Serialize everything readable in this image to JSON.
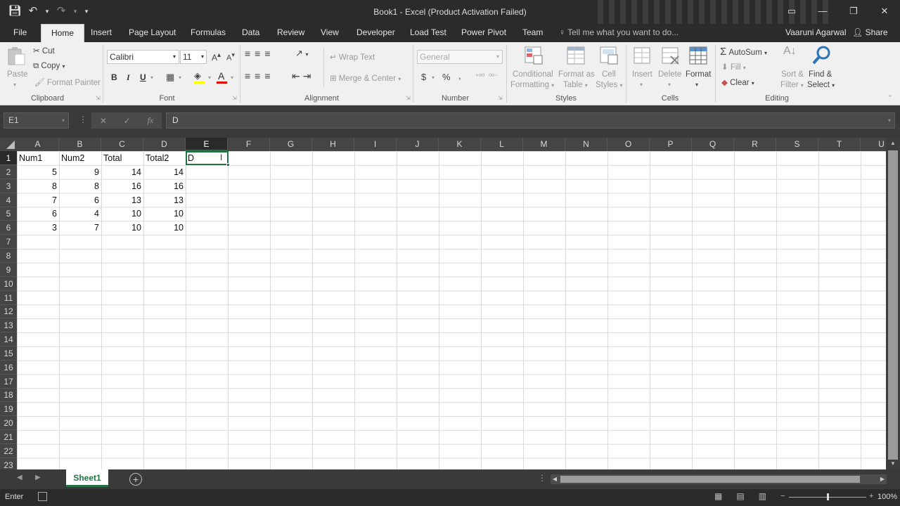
{
  "window": {
    "title": "Book1 - Excel (Product Activation Failed)",
    "controls": {
      "restore": "▭",
      "minimize": "—",
      "maximize": "❐",
      "close": "✕"
    }
  },
  "qat": {
    "save_icon": "save-icon",
    "undo_icon": "undo-icon",
    "redo_icon": "redo-icon"
  },
  "tabs": {
    "file": "File",
    "home": "Home",
    "insert": "Insert",
    "page_layout": "Page Layout",
    "formulas": "Formulas",
    "data": "Data",
    "review": "Review",
    "view": "View",
    "developer": "Developer",
    "load_test": "Load Test",
    "power_pivot": "Power Pivot",
    "team": "Team",
    "tell_me": "Tell me what you want to do...",
    "user": "Vaaruni Agarwal",
    "share": "Share"
  },
  "ribbon": {
    "clipboard": {
      "paste": "Paste",
      "cut": "Cut",
      "copy": "Copy",
      "format_painter": "Format Painter",
      "label": "Clipboard"
    },
    "font": {
      "name": "Calibri",
      "size": "11",
      "bold": "B",
      "italic": "I",
      "underline": "U",
      "label": "Font"
    },
    "alignment": {
      "wrap_text": "Wrap Text",
      "merge_center": "Merge & Center",
      "label": "Alignment"
    },
    "number": {
      "format": "General",
      "currency": "$",
      "percent": "%",
      "comma": ",",
      "label": "Number"
    },
    "styles": {
      "conditional": "Conditional",
      "conditional2": "Formatting",
      "format_as": "Format as",
      "format_as2": "Table",
      "cell_styles": "Cell",
      "cell_styles2": "Styles",
      "label": "Styles"
    },
    "cells": {
      "insert": "Insert",
      "delete": "Delete",
      "format": "Format",
      "label": "Cells"
    },
    "editing": {
      "autosum": "AutoSum",
      "fill": "Fill",
      "clear": "Clear",
      "sort": "Sort &",
      "sort2": "Filter",
      "find": "Find &",
      "find2": "Select",
      "label": "Editing"
    }
  },
  "formula_bar": {
    "name_box": "E1",
    "cancel": "✕",
    "enter": "✓",
    "fx": "fx",
    "content": "D"
  },
  "columns": [
    "A",
    "B",
    "C",
    "D",
    "E",
    "F",
    "G",
    "H",
    "I",
    "J",
    "K",
    "L",
    "M",
    "N",
    "O",
    "P",
    "Q",
    "R",
    "S",
    "T",
    "U"
  ],
  "rows": [
    "1",
    "2",
    "3",
    "4",
    "5",
    "6",
    "7",
    "8",
    "9",
    "10",
    "11",
    "12",
    "13",
    "14",
    "15",
    "16",
    "17",
    "18",
    "19",
    "20",
    "21",
    "22",
    "23"
  ],
  "sheet": {
    "headers": [
      "Num1",
      "Num2",
      "Total",
      "Total2"
    ],
    "data": [
      [
        "5",
        "9",
        "14",
        "14"
      ],
      [
        "8",
        "8",
        "16",
        "16"
      ],
      [
        "7",
        "6",
        "13",
        "13"
      ],
      [
        "6",
        "4",
        "10",
        "10"
      ],
      [
        "3",
        "7",
        "10",
        "10"
      ]
    ],
    "active_cell_value": "D"
  },
  "sheet_tabs": {
    "active": "Sheet1",
    "add": "+"
  },
  "status": {
    "mode": "Enter",
    "zoom": "100%",
    "zoom_minus": "−",
    "zoom_plus": "+"
  }
}
